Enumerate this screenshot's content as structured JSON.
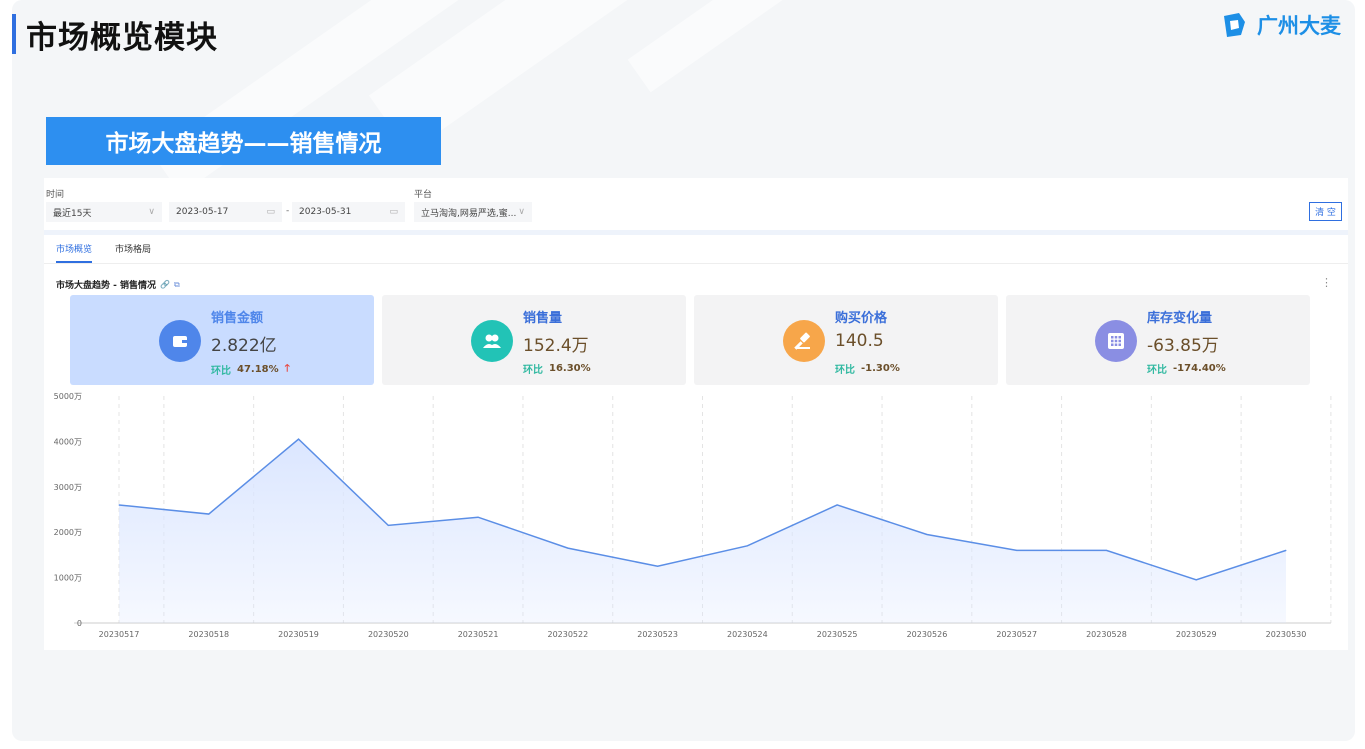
{
  "page": {
    "title": "市场概览模块"
  },
  "brand": {
    "name": "广州大麦",
    "color": "#1d8fe6"
  },
  "banner": {
    "text": "市场大盘趋势——销售情况",
    "color": "#2d8ff0"
  },
  "filters": {
    "time_label": "时间",
    "range_preset": "最近15天",
    "start_date": "2023-05-17",
    "end_date": "2023-05-31",
    "date_separator": "-",
    "platform_label": "平台",
    "platform_value": "立马淘淘,网易严选,蜜...",
    "clear_label": "清 空"
  },
  "tabs": [
    {
      "label": "市场概览",
      "active": true
    },
    {
      "label": "市场格局",
      "active": false
    }
  ],
  "section": {
    "title": "市场大盘趋势 - 销售情况"
  },
  "kpis": [
    {
      "label": "销售金额",
      "value": "2.822亿",
      "compare_label": "环比",
      "compare_value": "47.18%",
      "trend": "up",
      "icon": "wallet-icon",
      "icon_color": "#4f86ea",
      "label_color": "#4f86ea",
      "value_color": "#444444"
    },
    {
      "label": "销售量",
      "value": "152.4万",
      "compare_label": "环比",
      "compare_value": "16.30%",
      "icon": "users-icon",
      "icon_color": "#22c3b6",
      "label_color": "#3b6fd9",
      "value_color": "#6b4f2a"
    },
    {
      "label": "购买价格",
      "value": "140.5",
      "compare_label": "环比",
      "compare_value": "-1.30%",
      "icon": "gavel-icon",
      "icon_color": "#f7a64a",
      "label_color": "#3b6fd9",
      "value_color": "#6b4f2a"
    },
    {
      "label": "库存变化量",
      "value": "-63.85万",
      "compare_label": "环比",
      "compare_value": "-174.40%",
      "icon": "grid-icon",
      "icon_color": "#8a8ee3",
      "label_color": "#3b6fd9",
      "value_color": "#6b4f2a"
    }
  ],
  "chart_data": {
    "type": "area",
    "x": [
      "20230517",
      "20230518",
      "20230519",
      "20230520",
      "20230521",
      "20230522",
      "20230523",
      "20230524",
      "20230525",
      "20230526",
      "20230527",
      "20230528",
      "20230529",
      "20230530"
    ],
    "series": [
      {
        "values": [
          2600,
          2400,
          4050,
          2150,
          2330,
          1650,
          1250,
          1700,
          2600,
          1950,
          1600,
          1600,
          950,
          1600
        ]
      }
    ],
    "y_ticks": [
      "0",
      "1000万",
      "2000万",
      "3000万",
      "4000万",
      "5000万"
    ],
    "ylim": [
      0,
      5000
    ],
    "grid": "vertical dashed",
    "line_color": "#5b8ee6",
    "fill_color": "#dbe6ff"
  }
}
